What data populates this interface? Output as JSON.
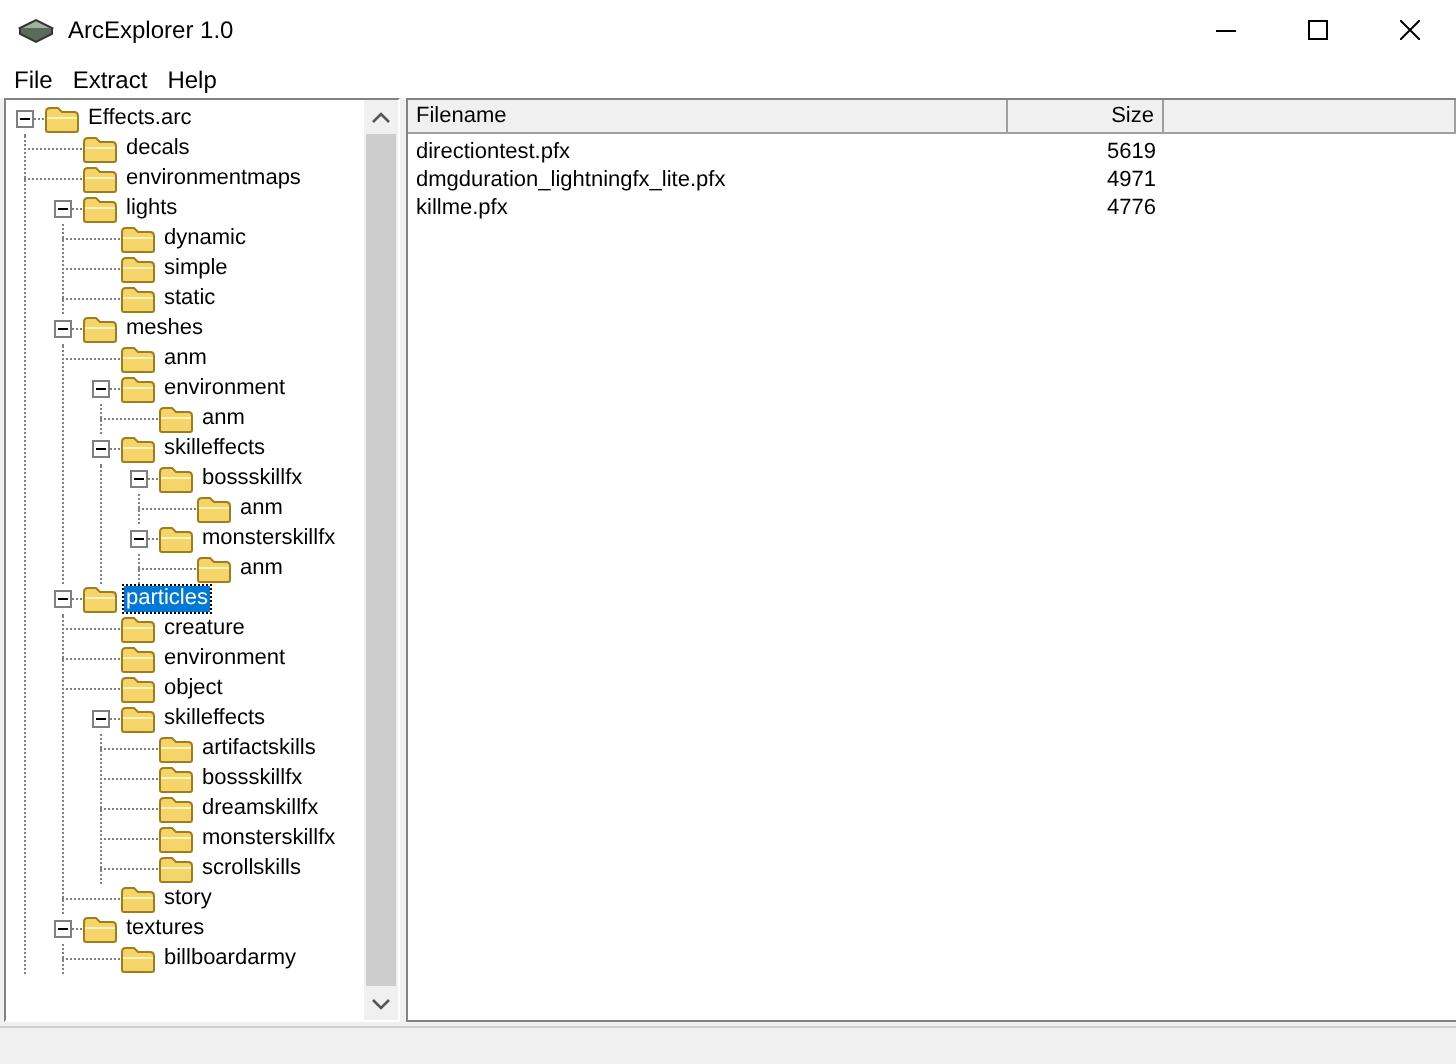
{
  "window": {
    "title": "ArcExplorer 1.0"
  },
  "menu": [
    "File",
    "Extract",
    "Help"
  ],
  "tree": [
    {
      "label": "Effects.arc",
      "expanded": true,
      "selected": false,
      "children": [
        {
          "label": "decals",
          "selected": false
        },
        {
          "label": "environmentmaps",
          "selected": false
        },
        {
          "label": "lights",
          "expanded": true,
          "selected": false,
          "children": [
            {
              "label": "dynamic",
              "selected": false
            },
            {
              "label": "simple",
              "selected": false
            },
            {
              "label": "static",
              "selected": false
            }
          ]
        },
        {
          "label": "meshes",
          "expanded": true,
          "selected": false,
          "children": [
            {
              "label": "anm",
              "selected": false
            },
            {
              "label": "environment",
              "expanded": true,
              "selected": false,
              "children": [
                {
                  "label": "anm",
                  "selected": false
                }
              ]
            },
            {
              "label": "skilleffects",
              "expanded": true,
              "selected": false,
              "children": [
                {
                  "label": "bossskillfx",
                  "expanded": true,
                  "selected": false,
                  "children": [
                    {
                      "label": "anm",
                      "selected": false
                    }
                  ]
                },
                {
                  "label": "monsterskillfx",
                  "expanded": true,
                  "selected": false,
                  "children": [
                    {
                      "label": "anm",
                      "selected": false
                    }
                  ]
                }
              ]
            }
          ]
        },
        {
          "label": "particles",
          "expanded": true,
          "selected": true,
          "children": [
            {
              "label": "creature",
              "selected": false
            },
            {
              "label": "environment",
              "selected": false
            },
            {
              "label": "object",
              "selected": false
            },
            {
              "label": "skilleffects",
              "expanded": true,
              "selected": false,
              "children": [
                {
                  "label": "artifactskills",
                  "selected": false
                },
                {
                  "label": "bossskillfx",
                  "selected": false
                },
                {
                  "label": "dreamskillfx",
                  "selected": false
                },
                {
                  "label": "monsterskillfx",
                  "selected": false
                },
                {
                  "label": "scrollskills",
                  "selected": false
                }
              ]
            },
            {
              "label": "story",
              "selected": false
            }
          ]
        },
        {
          "label": "textures",
          "expanded": true,
          "selected": false,
          "children": [
            {
              "label": "billboardarmy",
              "selected": false
            }
          ]
        }
      ]
    }
  ],
  "table": {
    "columns": [
      "Filename",
      "Size"
    ],
    "rows": [
      [
        "directiontest.pfx",
        "5619"
      ],
      [
        "dmgduration_lightningfx_lite.pfx",
        "4971"
      ],
      [
        "killme.pfx",
        "4776"
      ]
    ]
  }
}
